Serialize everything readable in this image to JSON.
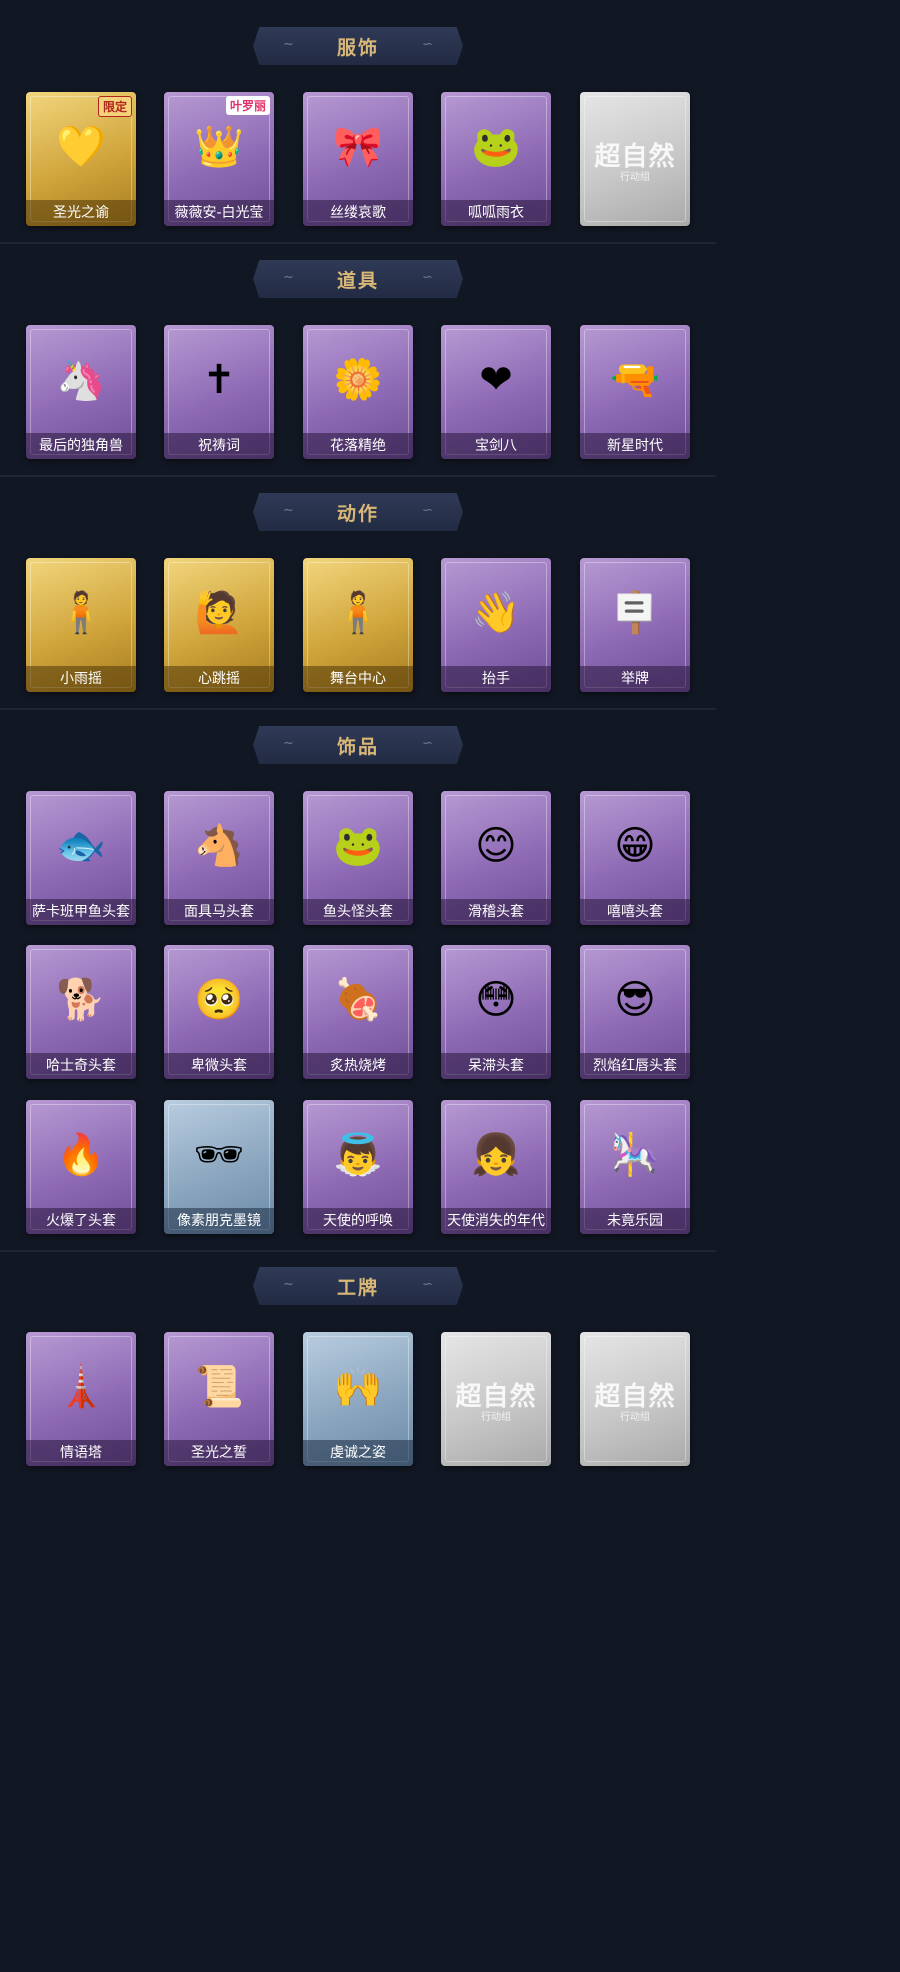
{
  "sections": [
    {
      "title": "服饰",
      "items": [
        {
          "name": "圣光之谕",
          "style": "gold",
          "badge": "限定",
          "badge_type": "limited",
          "icon": "💛"
        },
        {
          "name": "薇薇安-白光莹",
          "style": "purple",
          "badge": "叶罗丽",
          "badge_type": "collab",
          "icon": "👑"
        },
        {
          "name": "丝缕哀歌",
          "style": "purple",
          "icon": "🎀"
        },
        {
          "name": "呱呱雨衣",
          "style": "purple",
          "icon": "🐸"
        },
        {
          "name": "",
          "style": "gray",
          "logo": "超自然",
          "logo_sub": "行动组"
        }
      ]
    },
    {
      "title": "道具",
      "items": [
        {
          "name": "最后的独角兽",
          "style": "purple",
          "icon": "🦄"
        },
        {
          "name": "祝祷词",
          "style": "purple",
          "icon": "✝"
        },
        {
          "name": "花落精绝",
          "style": "purple",
          "icon": "🌼"
        },
        {
          "name": "宝剑八",
          "style": "purple",
          "icon": "❤"
        },
        {
          "name": "新星时代",
          "style": "purple",
          "icon": "🔫"
        }
      ]
    },
    {
      "title": "动作",
      "items": [
        {
          "name": "小雨摇",
          "style": "gold",
          "icon": "🧍"
        },
        {
          "name": "心跳摇",
          "style": "gold",
          "icon": "🙋"
        },
        {
          "name": "舞台中心",
          "style": "gold",
          "icon": "🧍"
        },
        {
          "name": "抬手",
          "style": "purple",
          "icon": "👋"
        },
        {
          "name": "举牌",
          "style": "purple",
          "icon": "🪧"
        }
      ]
    },
    {
      "title": "饰品",
      "items": [
        {
          "name": "萨卡班甲鱼头套",
          "style": "purple",
          "icon": "🐟"
        },
        {
          "name": "面具马头套",
          "style": "purple",
          "icon": "🐴"
        },
        {
          "name": "鱼头怪头套",
          "style": "purple",
          "icon": "🐸"
        },
        {
          "name": "滑稽头套",
          "style": "purple",
          "icon": "😊"
        },
        {
          "name": "嘻嘻头套",
          "style": "purple",
          "icon": "😁"
        },
        {
          "name": "哈士奇头套",
          "style": "purple",
          "icon": "🐕"
        },
        {
          "name": "卑微头套",
          "style": "purple",
          "icon": "🥺"
        },
        {
          "name": "炙热烧烤",
          "style": "purple",
          "icon": "🍖"
        },
        {
          "name": "呆滞头套",
          "style": "purple",
          "icon": "😳"
        },
        {
          "name": "烈焰红唇头套",
          "style": "purple",
          "icon": "😎"
        },
        {
          "name": "火爆了头套",
          "style": "purple",
          "icon": "🔥"
        },
        {
          "name": "像素朋克墨镜",
          "style": "blue",
          "icon": "🕶"
        },
        {
          "name": "天使的呼唤",
          "style": "purple",
          "icon": "👼"
        },
        {
          "name": "天使消失的年代",
          "style": "purple",
          "icon": "👧"
        },
        {
          "name": "未竟乐园",
          "style": "purple",
          "icon": "🎠"
        }
      ]
    },
    {
      "title": "工牌",
      "items": [
        {
          "name": "情语塔",
          "style": "purple",
          "icon": "🗼"
        },
        {
          "name": "圣光之誓",
          "style": "purple",
          "icon": "📜"
        },
        {
          "name": "虔诚之姿",
          "style": "blue",
          "icon": "🙌"
        },
        {
          "name": "",
          "style": "gray",
          "logo": "超自然",
          "logo_sub": "行动组"
        },
        {
          "name": "",
          "style": "gray",
          "logo": "超自然",
          "logo_sub": "行动组"
        }
      ]
    }
  ]
}
